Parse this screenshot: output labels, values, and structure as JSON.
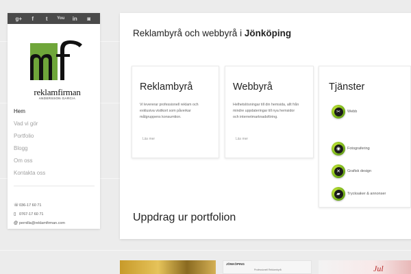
{
  "social": {
    "icons": [
      {
        "name": "google-plus-icon",
        "glyph": "g+"
      },
      {
        "name": "facebook-icon",
        "glyph": "f"
      },
      {
        "name": "twitter-icon",
        "glyph": "t"
      },
      {
        "name": "youtube-icon",
        "glyph": "You"
      },
      {
        "name": "linkedin-icon",
        "glyph": "in"
      },
      {
        "name": "instagram-icon",
        "glyph": "◙"
      }
    ]
  },
  "logo": {
    "monogram": "mf",
    "wordmark": "reklamfirman",
    "subline": "ANDERSSON GARCIA",
    "accent_color": "#6fa63a"
  },
  "nav": {
    "items": [
      {
        "label": "Hem",
        "active": true
      },
      {
        "label": "Vad vi gör",
        "active": false
      },
      {
        "label": "Portfolio",
        "active": false
      },
      {
        "label": "Blogg",
        "active": false
      },
      {
        "label": "Om oss",
        "active": false
      },
      {
        "label": "Kontakta oss",
        "active": false
      }
    ]
  },
  "contact": {
    "phone1": "036-17 60 71",
    "phone2": "0767-17 60 71",
    "email": "pernilla@reklamfirman.com"
  },
  "main": {
    "headline_prefix": "Reklambyrå och webbyrå i ",
    "headline_city": "Jönköping",
    "cards": [
      {
        "title": "Reklambyrå",
        "text": "Vi levererar professionell reklam och exklusiva visitkort som påverkar målgruppens konsumtion.",
        "link": "Läs mer"
      },
      {
        "title": "Webbyrå",
        "text": "Helhetslösningar till din hemsida, allt från mindre uppdateringar till nya hemsidor och internetmarknadsföring.",
        "link": "Läs mer"
      }
    ],
    "services": {
      "title": "Tjänster",
      "items": [
        {
          "label": "Webb",
          "icon": "tools-icon",
          "glyph": "✂"
        },
        {
          "label": "Fotografering",
          "icon": "camera-icon",
          "glyph": "◉"
        },
        {
          "label": "Grafisk design",
          "icon": "pencil-ruler-icon",
          "glyph": "✕"
        },
        {
          "label": "Trycksaker & annonser",
          "icon": "truck-icon",
          "glyph": "▰"
        }
      ]
    },
    "portfolio_heading": "Uppdrag ur portfolion"
  },
  "thumbnails": {
    "thumb2_title": "JÖNKÖPING",
    "thumb2_sub": "Professionell Reklambyrå",
    "thumb3_text": "Jul"
  }
}
